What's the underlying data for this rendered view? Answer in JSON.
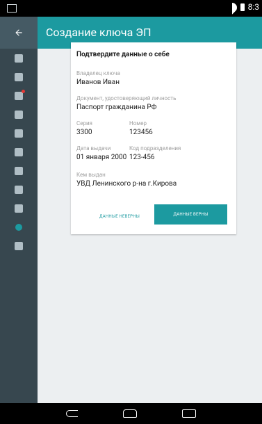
{
  "status_bar": {
    "time": "8:3"
  },
  "app_bar": {
    "title": "Создание ключа ЭП"
  },
  "sidebar": {
    "items": [
      {
        "name": "certificate-icon"
      },
      {
        "name": "folder-icon"
      },
      {
        "name": "mail-icon",
        "has_notification": true
      },
      {
        "name": "clipboard-icon"
      },
      {
        "name": "calendar-icon"
      },
      {
        "name": "calculator-icon"
      },
      {
        "name": "dollar-icon"
      },
      {
        "name": "chart-icon"
      },
      {
        "name": "clock-icon"
      },
      {
        "name": "settings-icon",
        "active": true
      },
      {
        "name": "logout-icon"
      }
    ],
    "active_color": "#1C9AA0"
  },
  "card": {
    "heading": "Подтвердите данные о себе",
    "owner": {
      "label": "Владелец ключа",
      "value": "Иванов Иван"
    },
    "document": {
      "label": "Документ, удостоверяющий личность",
      "value": "Паспорт гражданина РФ"
    },
    "series": {
      "label": "Серия",
      "value": "3300"
    },
    "number": {
      "label": "Номер",
      "value": "123456"
    },
    "issue_date": {
      "label": "Дата выдачи",
      "value": "01 января 2000"
    },
    "division_code": {
      "label": "Код подразделения",
      "value": "123-456"
    },
    "issued_by": {
      "label": "Кем выдан",
      "value": "УВД Ленинского р-на г.Кирова"
    },
    "buttons": {
      "incorrect": "ДАННЫЕ НЕВЕРНЫ",
      "correct": "ДАННЫЕ ВЕРНЫ"
    }
  },
  "colors": {
    "accent": "#1C9AA0",
    "sidebar": "#37474F",
    "back_area": "#455A64"
  }
}
